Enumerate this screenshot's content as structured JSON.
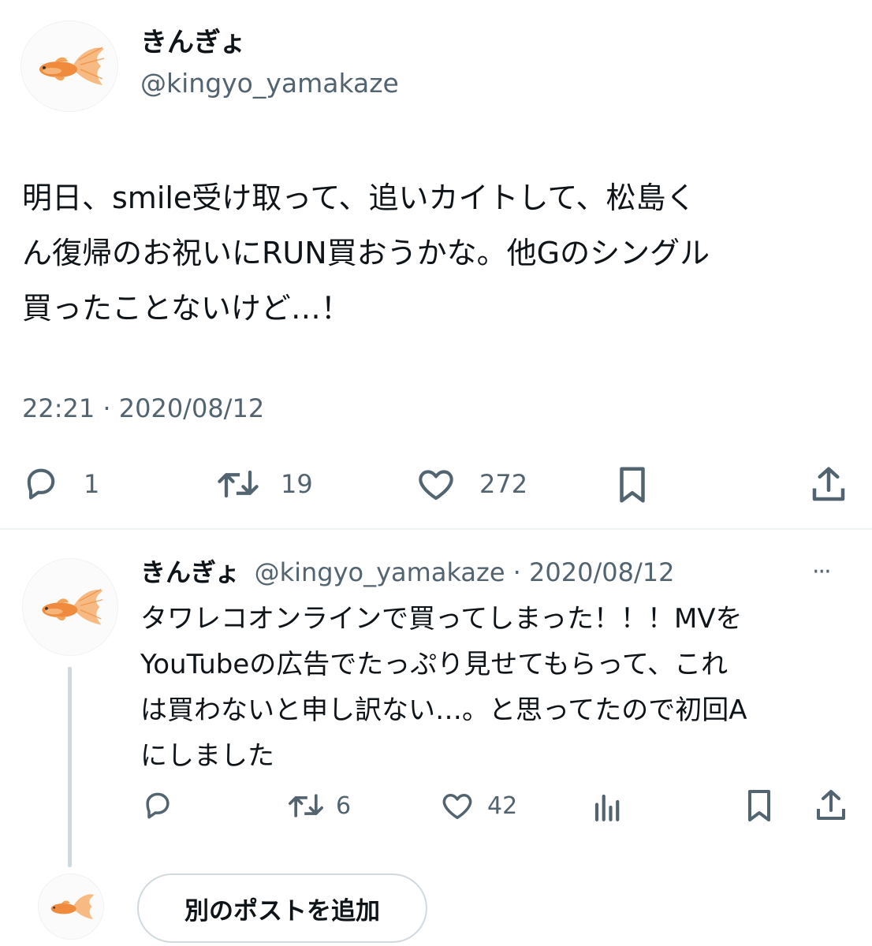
{
  "main_tweet": {
    "display_name": "きんぎょ",
    "handle": "@kingyo_yamakaze",
    "text_lines": [
      "明日、smile受け取って、追いカイトして、松島く",
      "ん復帰のお祝いにRUN買おうかな。他Gのシングル",
      "買ったことないけど…！"
    ],
    "timestamp": "22:21 · 2020/08/12",
    "stats": {
      "replies": "1",
      "reposts": "19",
      "likes": "272"
    }
  },
  "reply_tweet": {
    "display_name": "きんぎょ",
    "handle": "@kingyo_yamakaze",
    "separator": "·",
    "date": "2020/08/12",
    "more": "···",
    "text_lines": [
      "タワレコオンラインで買ってしまった！！！MVを",
      "YouTubeの広告でたっぷり見せてもらって、これ",
      "は買わないと申し訳ない…。と思ってたので初回A",
      "にしました"
    ],
    "stats": {
      "replies": "",
      "reposts": "6",
      "likes": "42"
    }
  },
  "composer": {
    "add_post_label": "別のポストを追加"
  },
  "colors": {
    "text": "#0f1419",
    "secondary": "#536471",
    "divider": "#eff3f4",
    "goldfish": "#f08a3c"
  },
  "icons": [
    "goldfish-avatar",
    "reply-icon",
    "repost-icon",
    "like-icon",
    "bookmark-icon",
    "share-icon",
    "views-icon",
    "more-icon"
  ]
}
